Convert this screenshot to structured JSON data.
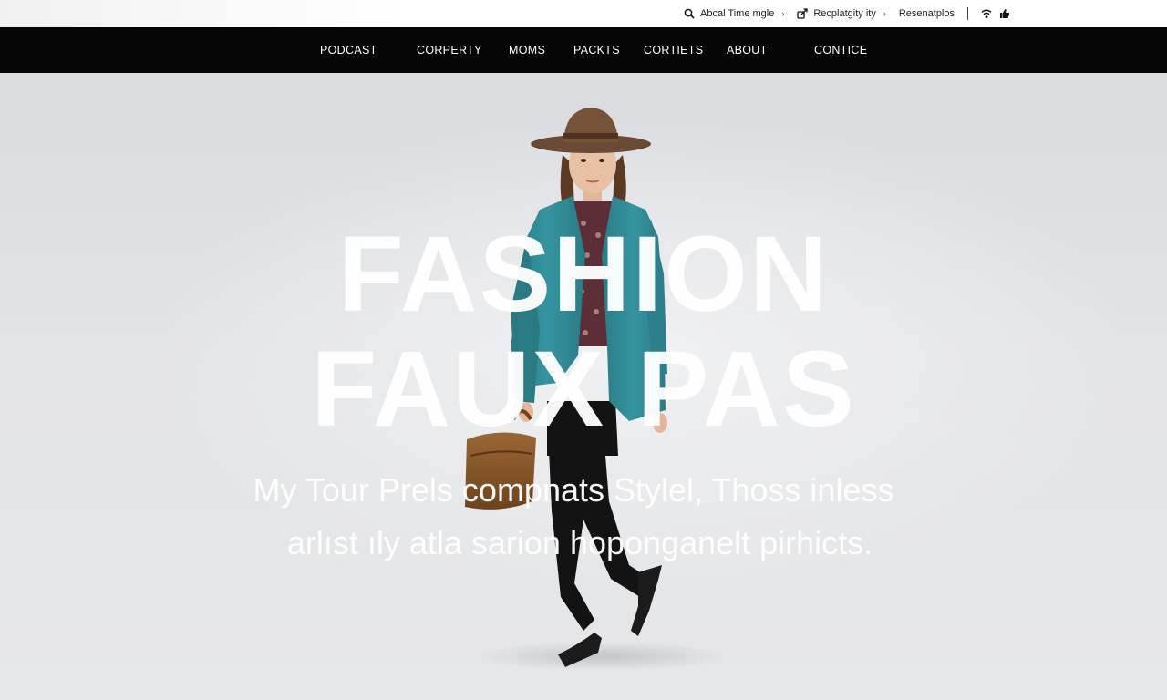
{
  "utility_bar": {
    "items": [
      {
        "icon": "search-icon",
        "label": "Abcal Time mgle",
        "chevron": "›"
      },
      {
        "icon": "share-icon",
        "label": "Recplatgity ity",
        "chevron": "›"
      },
      {
        "icon": "",
        "label": "Resenatplos",
        "chevron": ""
      }
    ],
    "end_icons": [
      "wifi-icon",
      "thumbs-up-icon"
    ]
  },
  "nav": {
    "items": [
      {
        "label": "PODCAST"
      },
      {
        "label": "CORPERTY"
      },
      {
        "label": "MOMS"
      },
      {
        "label": "PACKTS"
      },
      {
        "label": "CORTIETS"
      },
      {
        "label": "ABOUT"
      },
      {
        "label": "CONTICE"
      }
    ]
  },
  "hero": {
    "title_line1": "FASHION",
    "title_line2": "FAUX PAS",
    "subtitle_line1": "My Tour Prels compnats Stylel, Thoss inless",
    "subtitle_line2": "arlıst ıly atla sarion hoponganelt pirhicts."
  },
  "colors": {
    "nav_bg": "#050505",
    "jacket": "#2f8a95",
    "hat": "#6b4a35",
    "bag": "#8a5a2b",
    "hero_text": "#ffffff"
  }
}
